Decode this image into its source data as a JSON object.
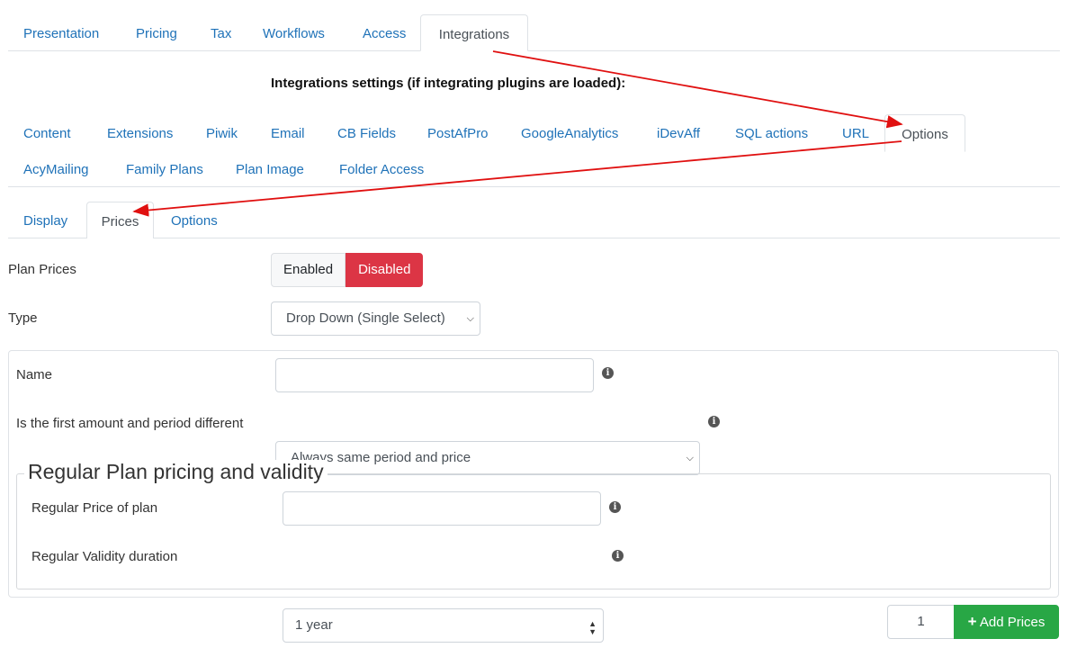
{
  "top_tabs": [
    "Presentation",
    "Pricing",
    "Tax",
    "Workflows",
    "Access",
    "Integrations"
  ],
  "integrations_heading": "Integrations settings (if integrating plugins are loaded):",
  "integration_tabs_row1": [
    "Content",
    "Extensions",
    "Piwik",
    "Email",
    "CB Fields",
    "PostAfPro",
    "GoogleAnalytics",
    "iDevAff",
    "SQL actions",
    "URL",
    "Options"
  ],
  "integration_tabs_row2": [
    "AcyMailing",
    "Family Plans",
    "Plan Image",
    "Folder Access"
  ],
  "sub_tabs": [
    "Display",
    "Prices",
    "Options"
  ],
  "plan_prices": {
    "label": "Plan Prices",
    "enabled": "Enabled",
    "disabled": "Disabled",
    "selected": "Disabled"
  },
  "type": {
    "label": "Type",
    "value": "Drop Down (Single Select)"
  },
  "name": {
    "label": "Name",
    "value": ""
  },
  "first_amount": {
    "label": "Is the first amount and period different",
    "value": "Always same period and price"
  },
  "regular_section": {
    "legend": "Regular Plan pricing and validity",
    "price_label": "Regular Price of plan",
    "price_value": "",
    "validity_label": "Regular Validity duration",
    "validity_value": "1 year"
  },
  "add_prices": {
    "count": "1",
    "button_label": "Add Prices",
    "icon": "plus-icon"
  },
  "colors": {
    "link": "#1f72b8",
    "danger": "#dc3545",
    "success": "#28a745",
    "annotation": "#e01010"
  }
}
